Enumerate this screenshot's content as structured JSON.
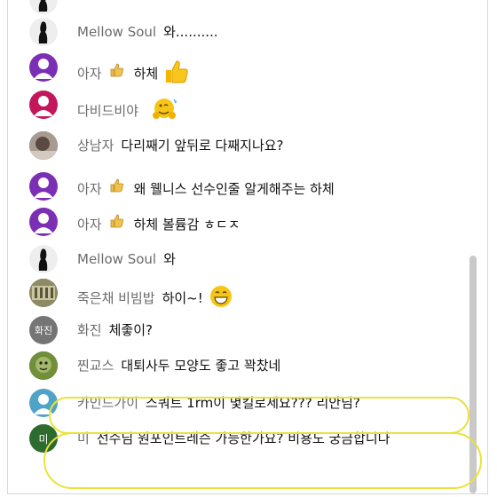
{
  "messages": [
    {
      "author": "",
      "text": "",
      "avatar": "silhouette",
      "color": "#eeeeee"
    },
    {
      "author": "Mellow Soul",
      "text": "와..........",
      "avatar": "silhouette",
      "color": "#eeeeee"
    },
    {
      "author": "아자",
      "badge": "thumbs-up",
      "text": "하체",
      "emoji": "thumbs-up-emoji",
      "avatar": "person-icon",
      "color": "#7b2fb5"
    },
    {
      "author": "다비드비야",
      "text": "",
      "emoji": "hugging-face-emoji",
      "avatar": "person-icon",
      "color": "#c2185b"
    },
    {
      "author": "상남자",
      "text": "다리째기 앞뒤로 다째지나요?",
      "avatar": "photo",
      "color": "#8a7a72"
    },
    {
      "author": "아자",
      "badge": "thumbs-up",
      "text": "왜 웰니스 선수인줄 알게해주는 하체",
      "avatar": "person-icon",
      "color": "#7b2fb5"
    },
    {
      "author": "아자",
      "badge": "thumbs-up",
      "text": "하체 볼륨감 ㅎㄷㅈ",
      "avatar": "person-icon",
      "color": "#7b2fb5"
    },
    {
      "author": "Mellow Soul",
      "text": "와",
      "avatar": "silhouette",
      "color": "#eeeeee"
    },
    {
      "author": "죽은채 비빔밥",
      "text": "하이~!",
      "emoji": "grinning-face-emoji",
      "avatar": "photo",
      "color": "#6d6a4a"
    },
    {
      "author": "화진",
      "text": "체좋이?",
      "avatar": "initials",
      "initials": "화진",
      "color": "#757575"
    },
    {
      "author": "찐교스",
      "text": "대퇴사두 모양도 좋고 꽉찼네",
      "avatar": "photo",
      "color": "#5b7a2e"
    },
    {
      "author": "카인드가이",
      "text": "스쿼트 1rm이 몇킬로세요??? 리안님?",
      "avatar": "person-icon",
      "color": "#4fa3c7"
    },
    {
      "author": "미",
      "text": "선수님 원포인트레슨 가능한가요? 비용도 궁금합니다",
      "avatar": "initials",
      "initials": "미",
      "color": "#2e6b2e"
    }
  ]
}
